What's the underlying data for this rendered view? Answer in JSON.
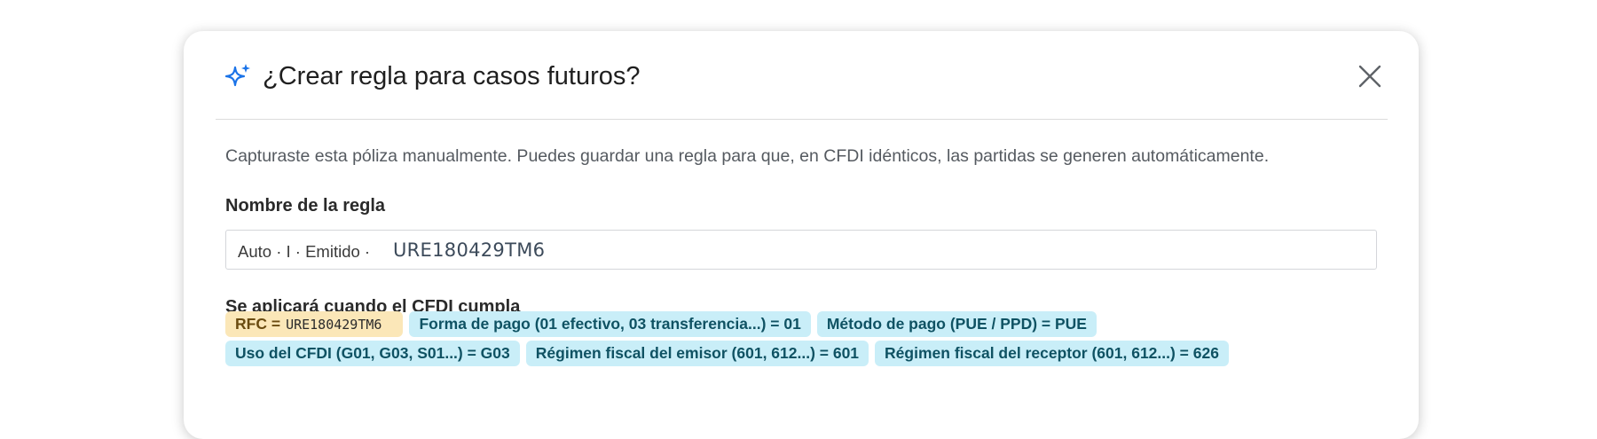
{
  "dialog": {
    "title": "¿Crear regla para casos futuros?",
    "title_icon": "sparkle-icon",
    "close_icon": "close-icon",
    "description": "Capturaste esta póliza manualmente. Puedes guardar una regla para que, en CFDI idénticos, las partidas se generen automáticamente."
  },
  "rule_name": {
    "label": "Nombre de la regla",
    "prefix": "Auto · I · Emitido ·",
    "value": "URE180429TM6"
  },
  "conditions": {
    "label": "Se aplicará cuando el CFDI cumpla",
    "rfc_label": "RFC =",
    "rfc_value": "URE180429TM6",
    "chips": [
      "Forma de pago (01 efectivo, 03 transferencia...) = 01",
      "Método de pago (PUE / PPD) = PUE",
      "Uso del CFDI (G01, G03, S01...) = G03",
      "Régimen fiscal del emisor (601, 612...) = 601",
      "Régimen fiscal del receptor (601, 612...) = 626"
    ]
  },
  "colors": {
    "accent": "#1a73e8",
    "chip_blue": "#c9eef8",
    "chip_yellow": "#fbe7b8"
  }
}
